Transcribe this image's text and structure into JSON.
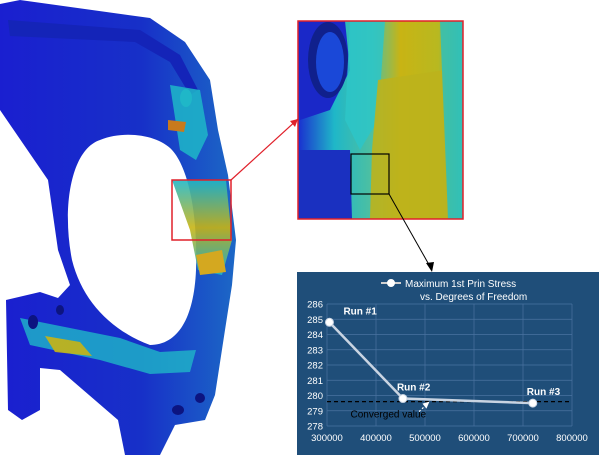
{
  "figure": {
    "palette": {
      "stress_low": "#1a1fd0",
      "stress_mid": "#1fb7c8",
      "stress_high": "#c8b414",
      "zoom_box": "#e0202a",
      "chart_bg": "#1f4e79"
    }
  },
  "chart_data": {
    "type": "line",
    "legend_title_line1": "Maximum 1st Prin Stress",
    "legend_title_line2": "vs. Degrees of Freedom",
    "x": [
      305000,
      455000,
      720000
    ],
    "series": [
      {
        "name": "Maximum 1st Prin Stress",
        "values": [
          284.8,
          279.8,
          279.5
        ]
      }
    ],
    "point_labels": [
      "Run #1",
      "Run #2",
      "Run #3"
    ],
    "converged_value": 279.6,
    "converged_label": "Converged value",
    "xlim": [
      300000,
      800000
    ],
    "ylim": [
      278,
      286
    ],
    "x_ticks": [
      "300000",
      "400000",
      "500000",
      "600000",
      "700000",
      "800000"
    ],
    "y_ticks": [
      "278",
      "279",
      "280",
      "281",
      "282",
      "283",
      "284",
      "285",
      "286"
    ],
    "grid": true,
    "legend": "top"
  }
}
